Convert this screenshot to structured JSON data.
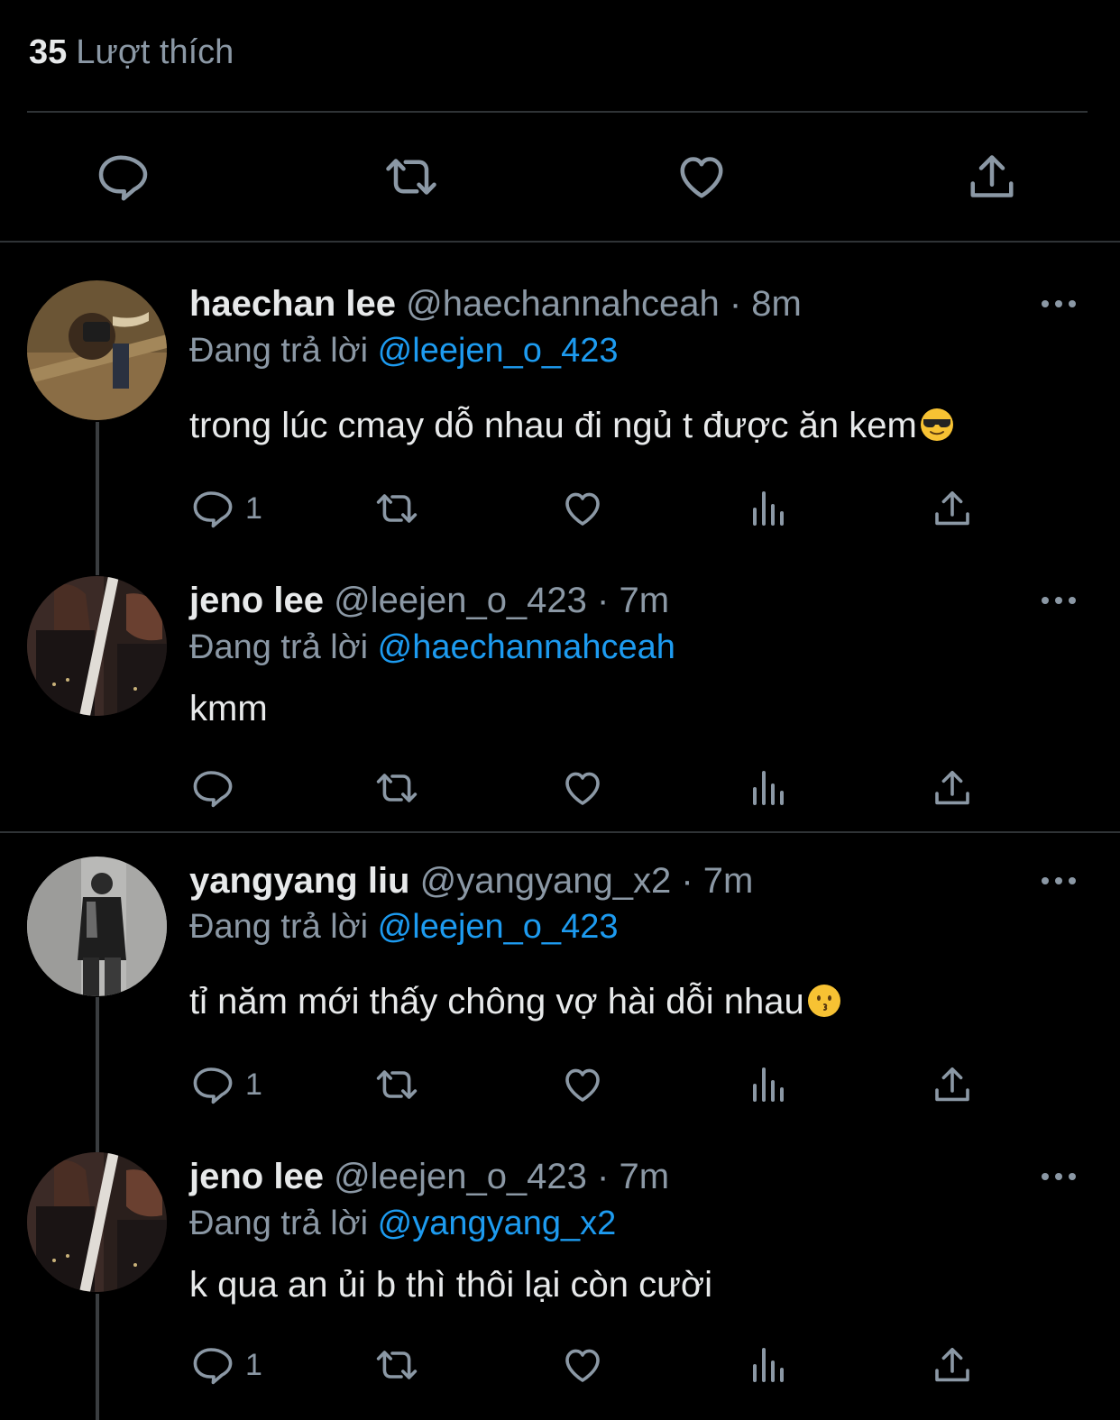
{
  "stats": {
    "likes_count": "35",
    "likes_label": "Lượt thích"
  },
  "main_actions": [
    "reply-icon",
    "retweet-icon",
    "like-icon",
    "share-icon"
  ],
  "colors": {
    "background": "#000000",
    "text": "#e7e9ea",
    "muted": "#8b98a5",
    "mention": "#1d9bf0",
    "divider": "#2f3336"
  },
  "replies": [
    {
      "name": "haechan lee",
      "handle": "@haechannahceah",
      "dot": "·",
      "time": "8m",
      "replying_label": "Đang trả lời",
      "replying_to": "@leejen_o_423",
      "text": "trong lúc cmay dỗ nhau đi ngủ t được ăn kem",
      "emoji": "sunglasses-face",
      "reply_count": "1"
    },
    {
      "name": "jeno lee",
      "handle": "@leejen_o_423",
      "dot": "·",
      "time": "7m",
      "replying_label": "Đang trả lời",
      "replying_to": "@haechannahceah",
      "text": "kmm",
      "reply_count": ""
    },
    {
      "name": "yangyang liu",
      "handle": "@yangyang_x2",
      "dot": "·",
      "time": "7m",
      "replying_label": "Đang trả lời",
      "replying_to": "@leejen_o_423",
      "text": "tỉ năm mới thấy chông vợ hài dỗi nhau",
      "emoji": "kissing-face",
      "reply_count": "1"
    },
    {
      "name": "jeno lee",
      "handle": "@leejen_o_423",
      "dot": "·",
      "time": "7m",
      "replying_label": "Đang trả lời",
      "replying_to": "@yangyang_x2",
      "text": "k qua an ủi b thì thôi lại còn cười",
      "reply_count": "1"
    }
  ]
}
